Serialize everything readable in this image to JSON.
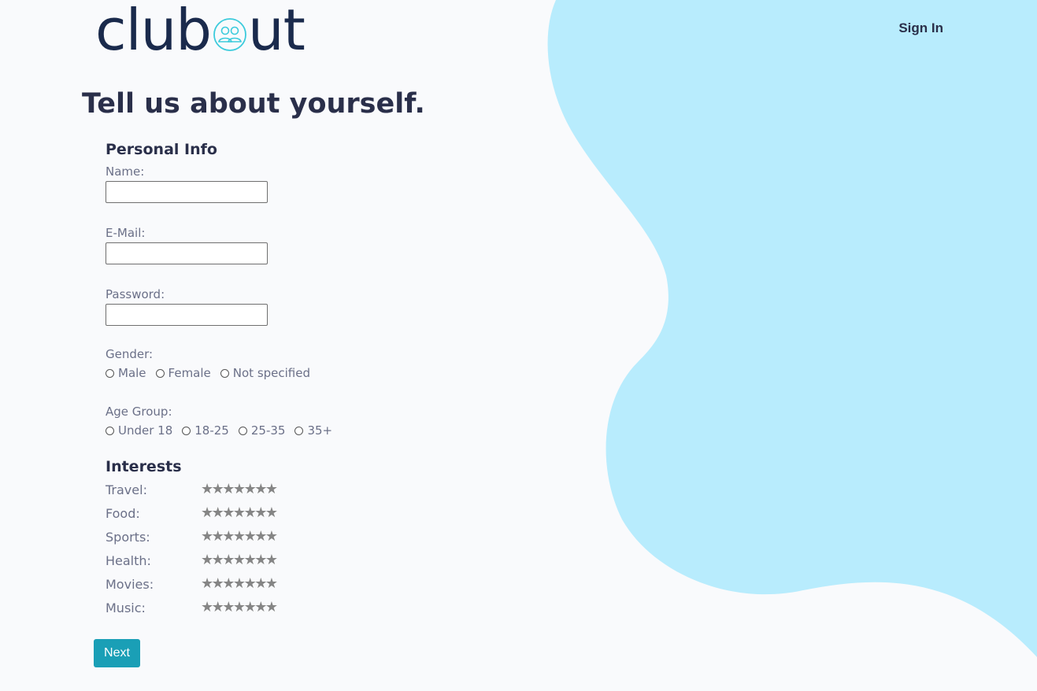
{
  "brand": {
    "logo_prefix": "club",
    "logo_suffix": "ut",
    "logo_icon": "group-icon",
    "color": "#1a2a4c",
    "accent": "#3ccbdc"
  },
  "header": {
    "signin_label": "Sign In"
  },
  "page": {
    "title": "Tell us about yourself."
  },
  "personal_info": {
    "heading": "Personal Info",
    "name_label": "Name:",
    "name_value": "",
    "email_label": "E-Mail:",
    "email_value": "",
    "password_label": "Password:",
    "password_value": ""
  },
  "gender": {
    "label": "Gender:",
    "options": [
      "Male",
      "Female",
      "Not specified"
    ]
  },
  "age_group": {
    "label": "Age Group:",
    "options": [
      "Under 18",
      "18-25",
      "25-35",
      "35+"
    ]
  },
  "interests": {
    "heading": "Interests",
    "max_stars": 7,
    "items": [
      {
        "label": "Travel:",
        "rating": 0
      },
      {
        "label": "Food:",
        "rating": 0
      },
      {
        "label": "Sports:",
        "rating": 0
      },
      {
        "label": "Health:",
        "rating": 0
      },
      {
        "label": "Movies:",
        "rating": 0
      },
      {
        "label": "Music:",
        "rating": 0
      }
    ]
  },
  "actions": {
    "next_label": "Next",
    "next_color": "#1a9fb6"
  },
  "theme": {
    "blob_color": "#b8ecfd",
    "background": "#f9fafc"
  }
}
